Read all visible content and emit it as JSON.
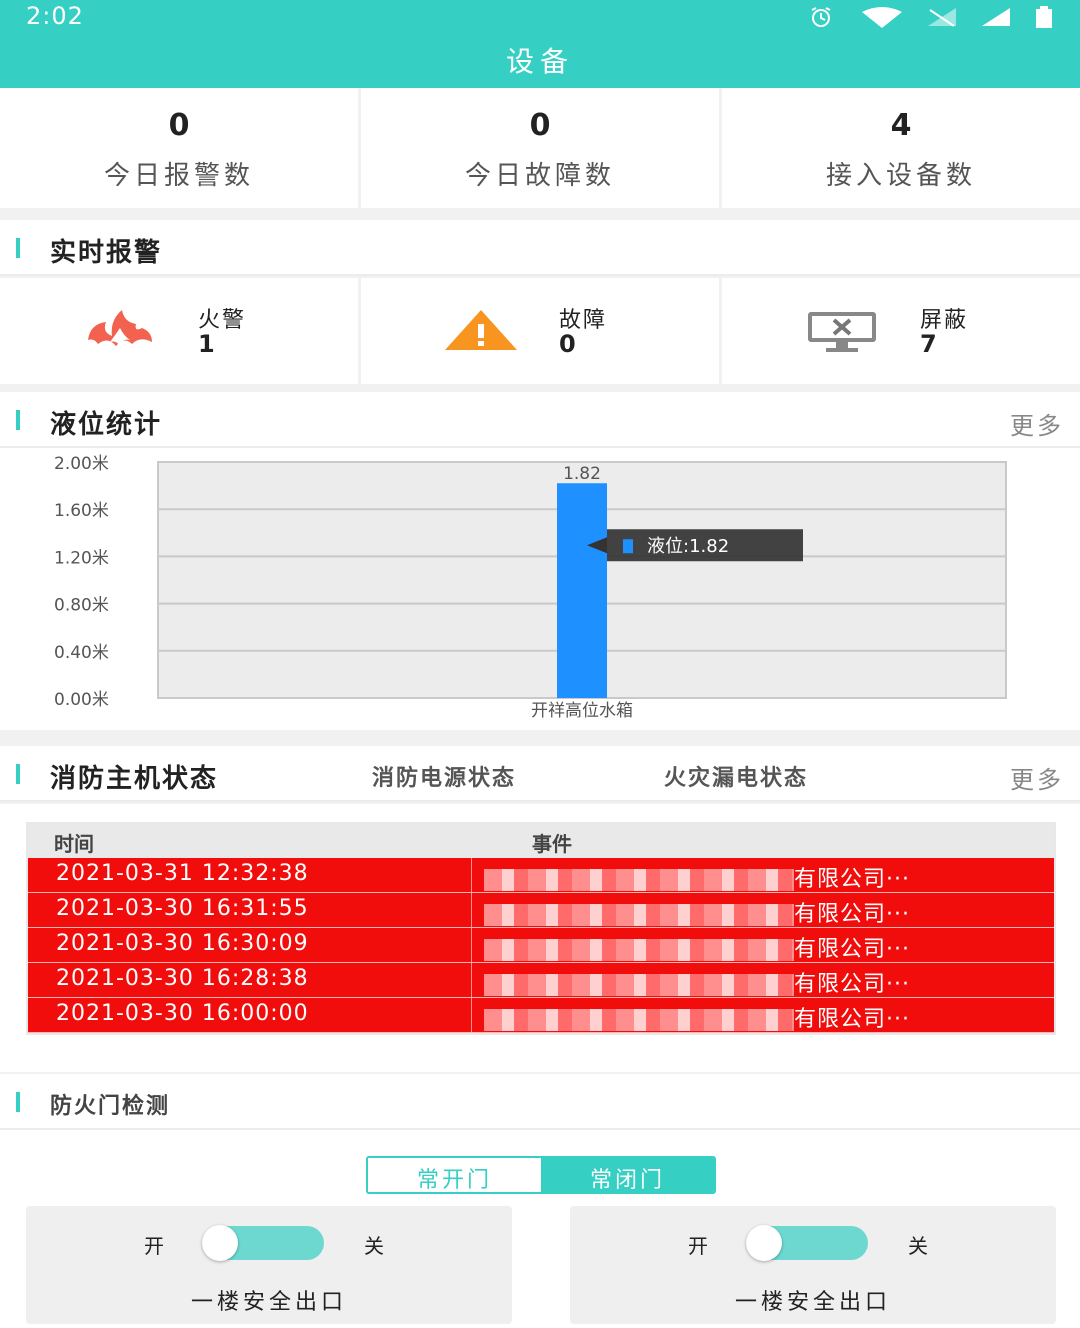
{
  "status_bar": {
    "time": "2:02"
  },
  "header": {
    "title": "设备"
  },
  "summary": [
    {
      "value": "0",
      "label": "今日报警数"
    },
    {
      "value": "0",
      "label": "今日故障数"
    },
    {
      "value": "4",
      "label": "接入设备数"
    }
  ],
  "realtime": {
    "title": "实时报警",
    "items": [
      {
        "label": "火警",
        "value": "1",
        "icon": "fire-icon"
      },
      {
        "label": "故障",
        "value": "0",
        "icon": "warning-icon"
      },
      {
        "label": "屏蔽",
        "value": "7",
        "icon": "monitor-off-icon"
      }
    ]
  },
  "level": {
    "title": "液位统计",
    "more": "更多",
    "tooltip": "液位:1.82"
  },
  "chart_data": {
    "type": "bar",
    "categories": [
      "开祥高位水箱"
    ],
    "values": [
      1.82
    ],
    "data_labels": [
      "1.82"
    ],
    "ylim": [
      0,
      2.0
    ],
    "yticks": [
      "0.00米",
      "0.40米",
      "0.80米",
      "1.20米",
      "1.60米",
      "2.00米"
    ],
    "bar_color": "#1e90ff",
    "grid": true
  },
  "host": {
    "tabs": [
      "消防主机状态",
      "消防电源状态",
      "火灾漏电状态"
    ],
    "more": "更多",
    "columns": [
      "时间",
      "事件"
    ],
    "rows": [
      {
        "time": "2021-03-31 12:32:38",
        "event": "有限公司···"
      },
      {
        "time": "2021-03-30 16:31:55",
        "event": "有限公司···"
      },
      {
        "time": "2021-03-30 16:30:09",
        "event": "有限公司···"
      },
      {
        "time": "2021-03-30 16:28:38",
        "event": "有限公司···"
      },
      {
        "time": "2021-03-30 16:00:00",
        "event": "有限公司···"
      }
    ]
  },
  "door": {
    "title": "防火门检测",
    "seg": [
      "常开门",
      "常闭门"
    ],
    "cards": [
      {
        "on": "开",
        "off": "关",
        "name": "一楼安全出口"
      },
      {
        "on": "开",
        "off": "关",
        "name": "一楼安全出口"
      }
    ]
  },
  "colors": {
    "accent": "#36cfc4",
    "alarm_row": "#f20d0d",
    "bar": "#1e90ff"
  }
}
